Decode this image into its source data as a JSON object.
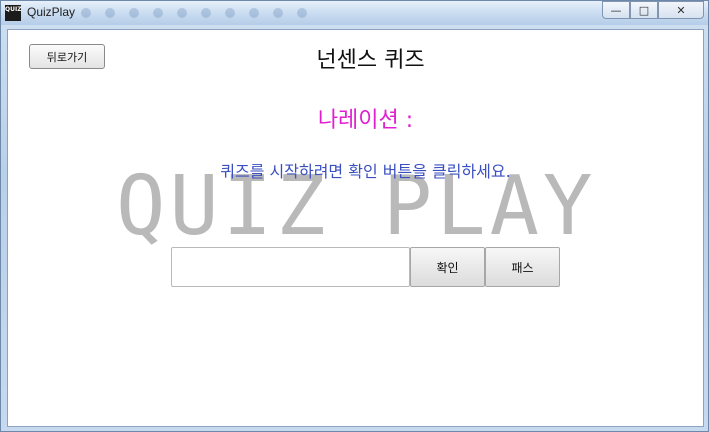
{
  "window": {
    "title": "QuizPlay",
    "icon_text": "QUIZ"
  },
  "window_controls": {
    "minimize": "—",
    "maximize": "□",
    "close": "✕"
  },
  "main": {
    "back_label": "뒤로가기",
    "page_title": "넌센스 퀴즈",
    "narration": "나레이션 :",
    "instruction": "퀴즈를 시작하려면 확인 버튼을 클릭하세요.",
    "watermark": "QUIZ PLAY",
    "answer_value": "",
    "answer_placeholder": "",
    "confirm_label": "확인",
    "pass_label": "패스"
  },
  "colors": {
    "narration": "#e020d0",
    "instruction": "#3a4fc0",
    "watermark": "#b9b9b9"
  }
}
